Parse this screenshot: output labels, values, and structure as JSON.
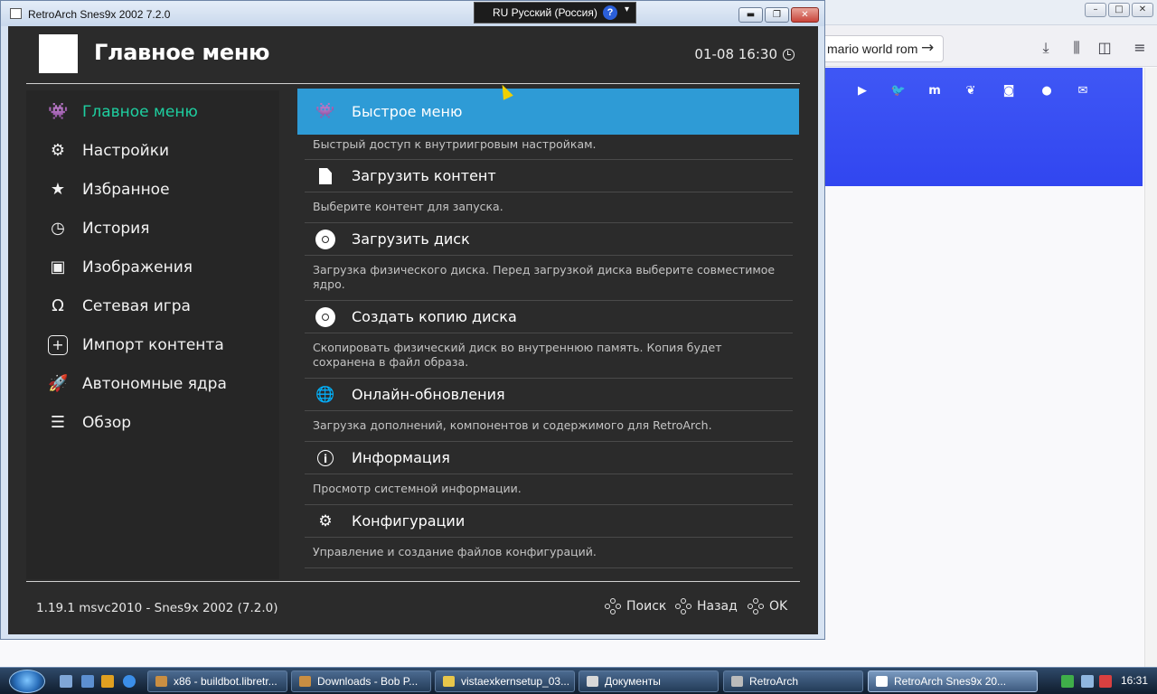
{
  "browser": {
    "url_text": "mario world rom",
    "social_icons": [
      "youtube-icon",
      "twitter-icon",
      "mastodon-icon",
      "bluesky-icon",
      "discord-icon",
      "github-icon",
      "mail-icon"
    ],
    "banner_color": "#3a50f3"
  },
  "langbar": {
    "language": "RU Русский (Россия)",
    "help": "?"
  },
  "window": {
    "title": "RetroArch Snes9x 2002 7.2.0"
  },
  "header": {
    "title": "Главное меню",
    "clock": "01-08 16:30"
  },
  "sidebar": {
    "items": [
      {
        "label": "Главное меню",
        "icon": "space-invader-icon",
        "active": true
      },
      {
        "label": "Настройки",
        "icon": "gear-icon",
        "active": false
      },
      {
        "label": "Избранное",
        "icon": "star-icon",
        "active": false
      },
      {
        "label": "История",
        "icon": "history-icon",
        "active": false
      },
      {
        "label": "Изображения",
        "icon": "image-icon",
        "active": false
      },
      {
        "label": "Сетевая игра",
        "icon": "headset-icon",
        "active": false
      },
      {
        "label": "Импорт контента",
        "icon": "plus-icon",
        "active": false
      },
      {
        "label": "Автономные ядра",
        "icon": "rocket-icon",
        "active": false
      },
      {
        "label": "Обзор",
        "icon": "database-icon",
        "active": false
      }
    ],
    "active_color": "#1ecfa0"
  },
  "menu": {
    "selected_color": "#2e9bd6",
    "entries": [
      {
        "label": "Быстрое меню",
        "icon": "space-invader-icon",
        "description": "Быстрый доступ к внутриигровым настройкам."
      },
      {
        "label": "Загрузить контент",
        "icon": "file-icon",
        "description": "Выберите контент для запуска."
      },
      {
        "label": "Загрузить диск",
        "icon": "disc-icon",
        "description": "Загрузка физического диска. Перед загрузкой диска выберите совместимое ядро."
      },
      {
        "label": "Создать копию диска",
        "icon": "disc-icon",
        "description": "Скопировать физический диск во внутреннюю память. Копия будет сохранена в файл образа."
      },
      {
        "label": "Онлайн-обновления",
        "icon": "globe-icon",
        "description": "Загрузка дополнений, компонентов и содержимого для RetroArch."
      },
      {
        "label": "Информация",
        "icon": "info-icon",
        "description": "Просмотр системной информации."
      },
      {
        "label": "Конфигурации",
        "icon": "gears-icon",
        "description": "Управление и создание файлов конфигураций."
      }
    ]
  },
  "footer": {
    "version": "1.19.1 msvc2010 - Snes9x 2002 (7.2.0)",
    "search": "Поиск",
    "back": "Назад",
    "ok": "OK"
  },
  "taskbar": {
    "tasks": [
      {
        "label": "x86 - buildbot.libretr...",
        "active": false
      },
      {
        "label": "Downloads - Bob P...",
        "active": false
      },
      {
        "label": "vistaexkernsetup_03...",
        "active": false
      },
      {
        "label": "Документы",
        "active": false
      },
      {
        "label": "RetroArch",
        "active": false
      },
      {
        "label": "RetroArch Snes9x 20...",
        "active": true
      }
    ],
    "clock": "16:31"
  }
}
